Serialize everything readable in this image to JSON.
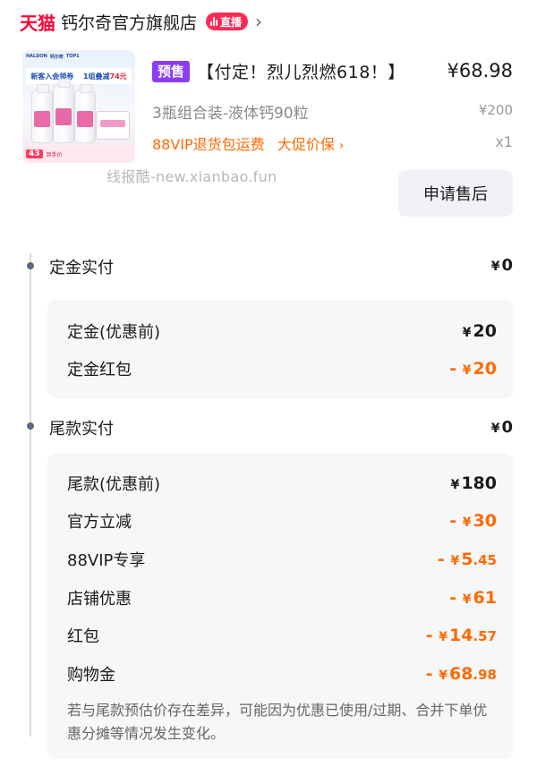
{
  "store": {
    "brand": "天猫",
    "name": "钙尔奇官方旗舰店",
    "live_badge": "直播",
    "chevron": "›"
  },
  "product": {
    "image": {
      "top_logos": [
        "HALDON",
        "钙尔奇",
        "TOP1"
      ],
      "banner_left": "新客入会领券",
      "banner_right_prefix": "1组叠减",
      "banner_right_amount": "74元",
      "bottom_price": "43",
      "bottom_text": "到手价"
    },
    "presale_tag": "预售",
    "title": "【付定！烈儿烈燃618！】",
    "price": "¥68.98",
    "variant": "3瓶组合装-液体钙90粒",
    "original_price": "¥200",
    "service_left": "88VIP退货包运费",
    "service_right": "大促价保",
    "service_chevron": "›",
    "quantity": "x1",
    "after_sale_button": "申请售后"
  },
  "watermark": "线报酷-new.xianbao.fun",
  "deposit": {
    "title": "定金实付",
    "currency": "¥",
    "value": "0",
    "rows": [
      {
        "label": "定金(优惠前)",
        "sign": "",
        "currency": "¥",
        "int": "20",
        "dec": ""
      },
      {
        "label": "定金红包",
        "sign": "- ",
        "currency": "¥",
        "int": "20",
        "dec": ""
      }
    ]
  },
  "balance": {
    "title": "尾款实付",
    "currency": "¥",
    "value": "0",
    "rows": [
      {
        "label": "尾款(优惠前)",
        "sign": "",
        "currency": "¥",
        "int": "180",
        "dec": ""
      },
      {
        "label": "官方立减",
        "sign": "- ",
        "currency": "¥",
        "int": "30",
        "dec": ""
      },
      {
        "label": "88VIP专享",
        "sign": "- ",
        "currency": "¥",
        "int": "5",
        "dec": ".45"
      },
      {
        "label": "店铺优惠",
        "sign": "- ",
        "currency": "¥",
        "int": "61",
        "dec": ""
      },
      {
        "label": "红包",
        "sign": "- ",
        "currency": "¥",
        "int": "14",
        "dec": ".57"
      },
      {
        "label": "购物金",
        "sign": "- ",
        "currency": "¥",
        "int": "68",
        "dec": ".98"
      }
    ],
    "note": "若与尾款预估价存在差异，可能因为优惠已使用/过期、合并下单优惠分摊等情况发生变化。"
  },
  "colors": {
    "tmall_red": "#ff0036",
    "presale_purple": "#8b3df7",
    "discount_orange": "#ff6a00",
    "card_bg": "#f6f7f9"
  },
  "icons": [
    "live-bars-icon",
    "chevron-right-icon",
    "timeline-dot-icon"
  ]
}
